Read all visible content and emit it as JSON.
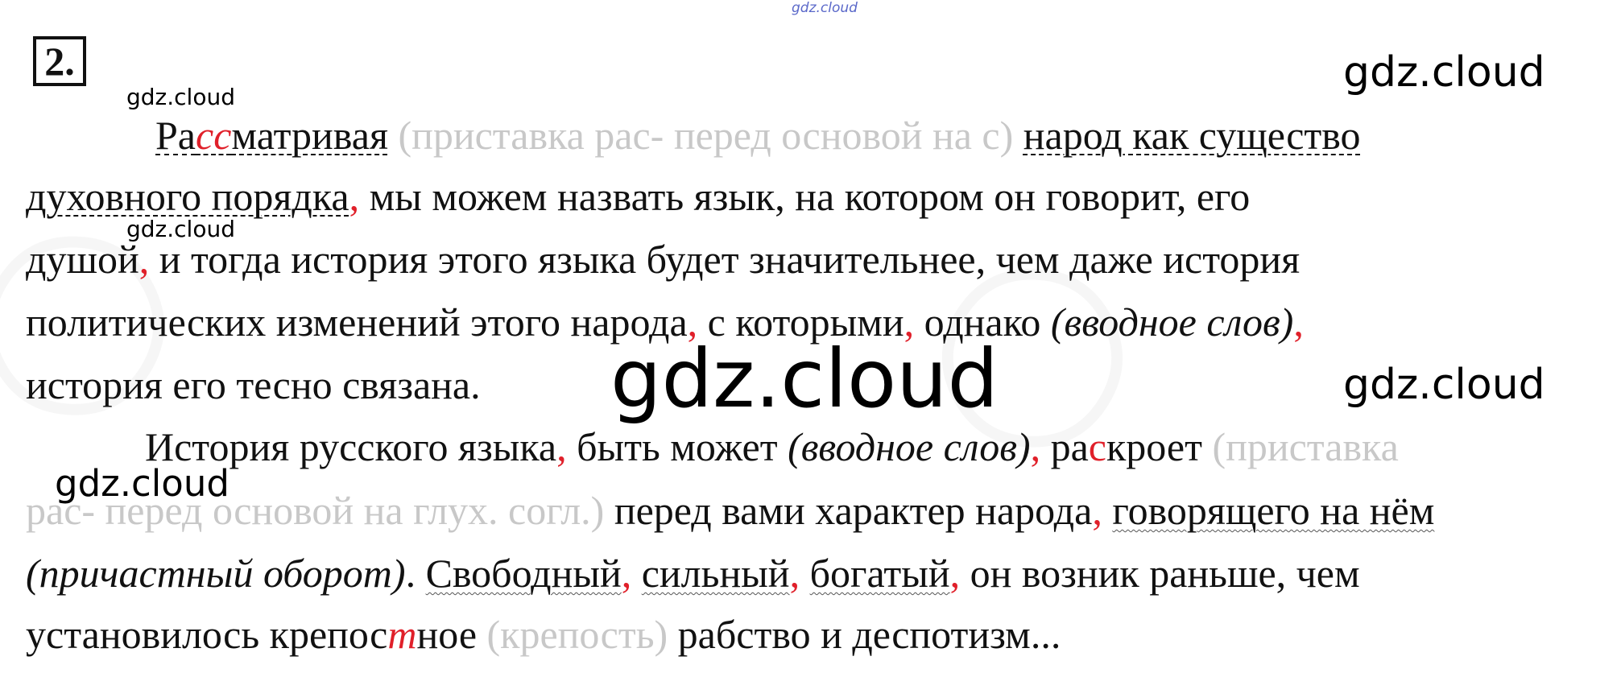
{
  "watermarks": {
    "top": "gdz.cloud",
    "small_1": "gdz.cloud",
    "small_2": "gdz.cloud",
    "small_3": "gdz.cloud",
    "medium_1": "gdz.cloud",
    "medium_2": "gdz.cloud",
    "large": "gdz.cloud"
  },
  "task_number": "2.",
  "lines": {
    "l1": {
      "word_a": "Ра",
      "word_b": "сс",
      "word_c": "матривая",
      "note": "(приставка рас- перед основой на с)",
      "phrase": "народ как существо"
    },
    "l2": {
      "phrase": "духовного порядка",
      "comma": ",",
      "rest": "мы можем назвать язык, на котором он говорит, его"
    },
    "l3": {
      "a": "душой",
      "comma": ",",
      "b": "и тогда история этого языка будет значительнее, чем даже история"
    },
    "l4": {
      "a": "политических изменений этого народа",
      "comma1": ",",
      "b": "с которыми",
      "comma2": ",",
      "c": "однако",
      "note": "(вводное слов)",
      "comma3": ","
    },
    "l5": {
      "text": "история его тесно связана."
    },
    "l6": {
      "a": "История русского языка",
      "comma1": ",",
      "b": "быть может",
      "note": "(вводное слов)",
      "comma2": ",",
      "word_a": "ра",
      "word_b": "с",
      "word_c": "кроет",
      "note2": "(приставка"
    },
    "l7": {
      "note": "рас- перед основой на глух. согл.)",
      "a": "перед вами характер народа",
      "comma": ",",
      "phrase": "говорящего на нём"
    },
    "l8": {
      "note": "(причастный оборот)",
      "period": ".",
      "w1": "Свободный",
      "c1": ",",
      "w2": "сильный",
      "c2": ",",
      "w3": "богатый",
      "c3": ",",
      "rest": "он возник раньше, чем"
    },
    "l9": {
      "a": "установилось крепос",
      "b": "т",
      "c": "ное",
      "note": "(крепость)",
      "d": "рабство и деспотизм..."
    }
  }
}
